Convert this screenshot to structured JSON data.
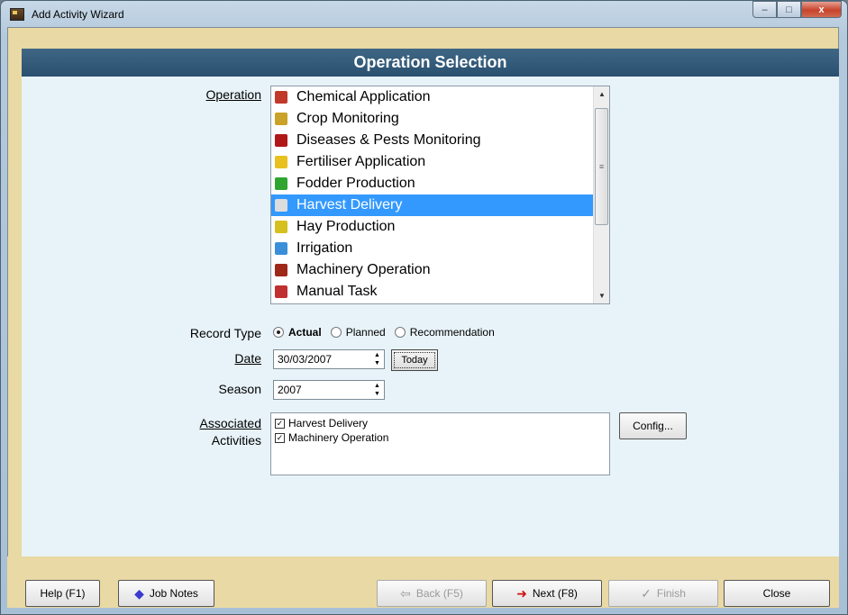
{
  "window": {
    "title": "Add Activity Wizard",
    "minimize": "–",
    "maximize": "□",
    "close": "x"
  },
  "header": {
    "title": "Operation Selection"
  },
  "operation": {
    "label": "Operation",
    "items": [
      {
        "label": "Chemical Application",
        "icon": "chemical-icon",
        "color": "#c0392b"
      },
      {
        "label": "Crop Monitoring",
        "icon": "magnifier-icon",
        "color": "#c9a227"
      },
      {
        "label": "Diseases & Pests Monitoring",
        "icon": "bug-icon",
        "color": "#b01818"
      },
      {
        "label": "Fertiliser Application",
        "icon": "fertiliser-bag-icon",
        "color": "#e8c020"
      },
      {
        "label": "Fodder Production",
        "icon": "fodder-icon",
        "color": "#2fa52f"
      },
      {
        "label": "Harvest Delivery",
        "icon": "harvest-icon",
        "color": "#dddddd",
        "selected": true
      },
      {
        "label": "Hay Production",
        "icon": "hay-bale-icon",
        "color": "#d6c020"
      },
      {
        "label": "Irrigation",
        "icon": "water-drop-icon",
        "color": "#3a8fd8"
      },
      {
        "label": "Machinery Operation",
        "icon": "tractor-icon",
        "color": "#a02818"
      },
      {
        "label": "Manual Task",
        "icon": "hand-tool-icon",
        "color": "#c03030"
      }
    ]
  },
  "record_type": {
    "label": "Record Type",
    "options": [
      {
        "label": "Actual",
        "checked": true
      },
      {
        "label": "Planned",
        "checked": false
      },
      {
        "label": "Recommendation",
        "checked": false
      }
    ]
  },
  "date": {
    "label": "Date",
    "value": "30/03/2007",
    "today_label": "Today"
  },
  "season": {
    "label": "Season",
    "value": "2007"
  },
  "associated": {
    "label_line1": "Associated",
    "label_line2": "Activities",
    "items": [
      {
        "label": "Harvest Delivery",
        "checked": true
      },
      {
        "label": "Machinery Operation",
        "checked": true
      }
    ],
    "config_label": "Config..."
  },
  "footer": {
    "help": "Help (F1)",
    "job_notes": "Job Notes",
    "back": "Back (F5)",
    "next": "Next (F8)",
    "finish": "Finish",
    "close": "Close"
  }
}
